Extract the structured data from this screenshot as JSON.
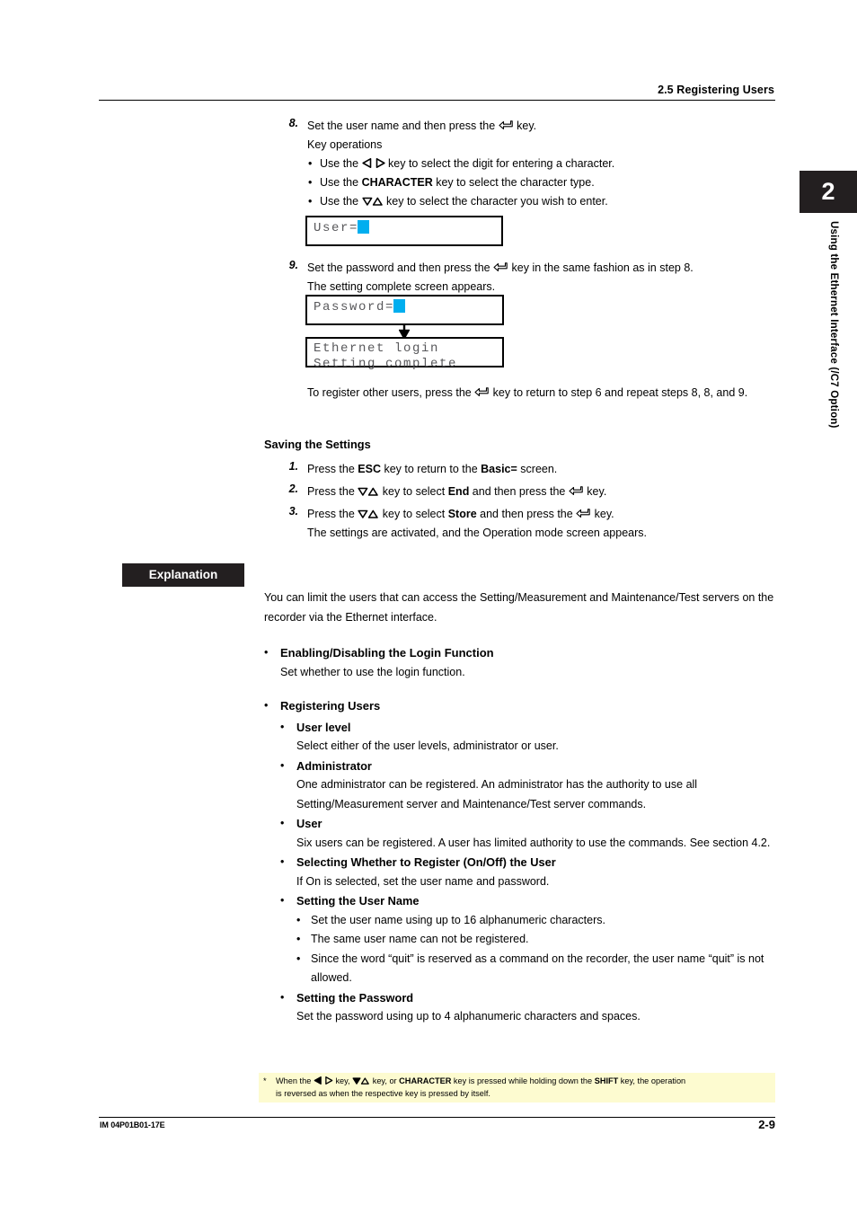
{
  "header": {
    "title": "2.5  Registering Users"
  },
  "chapter_tab": {
    "number": "2",
    "label": "Using the Ethernet Interface (/C7 Option)"
  },
  "steps": [
    {
      "num": "8.",
      "text_before": "Set the user name and then press the ",
      "icon": "enter-key-icon",
      "text_after": " key."
    },
    {
      "num": "9.",
      "text_before": "Set the password and then press the ",
      "icon": "enter-key-icon",
      "text_after": " key in the same fashion as in step 8.",
      "line2": "The setting complete screen appears."
    }
  ],
  "key_operations": {
    "label": "Key operations",
    "bullets": [
      {
        "pre": "Use the ",
        "icon": "left-right-arrow-key-icon",
        "post": " key to select the digit for entering a character."
      },
      {
        "pre": "Use the ",
        "bold": "CHARACTER",
        "post": " key to select the character type."
      },
      {
        "pre": "Use the ",
        "icon": "up-down-arrow-key-icon",
        "post": " key to select the character you wish to enter."
      }
    ]
  },
  "lcd_screens": {
    "user": {
      "line1": "User=",
      "cursor": true,
      "line2": ""
    },
    "password": {
      "line1": "Password=",
      "cursor": true,
      "line2": ""
    },
    "complete": {
      "line1": "Ethernet login",
      "line2": "Setting complete"
    },
    "arrow": "down-arrow-icon"
  },
  "after_steps": {
    "pre": "To register other users, press the ",
    "icon": "enter-key-icon",
    "post": " key to return to step 6 and repeat steps 8, 8, and 9."
  },
  "saving": {
    "heading": "Saving the Settings",
    "steps": [
      {
        "num": "1.",
        "parts": [
          {
            "t": "Press the "
          },
          {
            "t": "ESC",
            "b": true
          },
          {
            "t": " key to return to the "
          },
          {
            "t": "Basic=",
            "b": true
          },
          {
            "t": " screen."
          }
        ]
      },
      {
        "num": "2.",
        "parts": [
          {
            "t": "Press the "
          },
          {
            "icon": "up-down-arrow-key-icon"
          },
          {
            "t": " key to select "
          },
          {
            "t": "End",
            "b": true
          },
          {
            "t": " and then press the "
          },
          {
            "icon": "enter-key-icon"
          },
          {
            "t": " key."
          }
        ]
      },
      {
        "num": "3.",
        "parts": [
          {
            "t": "Press the "
          },
          {
            "icon": "up-down-arrow-key-icon"
          },
          {
            "t": " key to select "
          },
          {
            "t": "Store",
            "b": true
          },
          {
            "t": " and then press the "
          },
          {
            "icon": "enter-key-icon"
          },
          {
            "t": " key."
          }
        ],
        "line2": "The settings are activated, and the Operation mode screen appears."
      }
    ]
  },
  "explanation": {
    "tag": "Explanation",
    "intro": "You can limit the users that can access the Setting/Measurement and Maintenance/Test servers on the recorder via the Ethernet interface.",
    "items": [
      {
        "title": "Enabling/Disabling the Login Function",
        "desc": "Set whether to use the login function."
      },
      {
        "title": "Registering Users",
        "sub": [
          {
            "title": "User level",
            "desc": "Select either of the user levels, administrator or user."
          },
          {
            "title": "Administrator",
            "desc": "One administrator can be registered. An administrator has the authority to use all Setting/Measurement server and Maintenance/Test server commands."
          },
          {
            "title": "User",
            "desc": "Six users can be registered. A user has limited authority to use the commands. See section 4.2."
          },
          {
            "title": "Selecting Whether to Register (On/Off) the User",
            "desc": "If On is selected, set the user name and password."
          },
          {
            "title": "Setting the User Name",
            "bullets": [
              "Set the user name using up to 16 alphanumeric characters.",
              "The same user name can not be registered.",
              "Since the word “quit” is reserved as a command on the recorder, the user name “quit” is not allowed."
            ]
          },
          {
            "title": "Setting the Password",
            "desc": "Set the password using up to 4 alphanumeric characters and spaces."
          }
        ]
      }
    ]
  },
  "footnote": {
    "star": "*",
    "p1": "When the ",
    "p2": " key,  ",
    "p3": " key, or ",
    "bold1": "CHARACTER",
    "p4": " key is pressed while holding down the ",
    "bold2": "SHIFT",
    "p5": " key, the operation",
    "line2": "is reversed as when the respective key is pressed by itself."
  },
  "footer": {
    "doc_number": "IM 04P01B01-17E",
    "page_number": "2-9"
  },
  "colors": {
    "cursor": "#00AEEF",
    "tag_black": "#231f20",
    "footnote_bg": "#fdfbd0",
    "lcd_text": "#58585b"
  }
}
